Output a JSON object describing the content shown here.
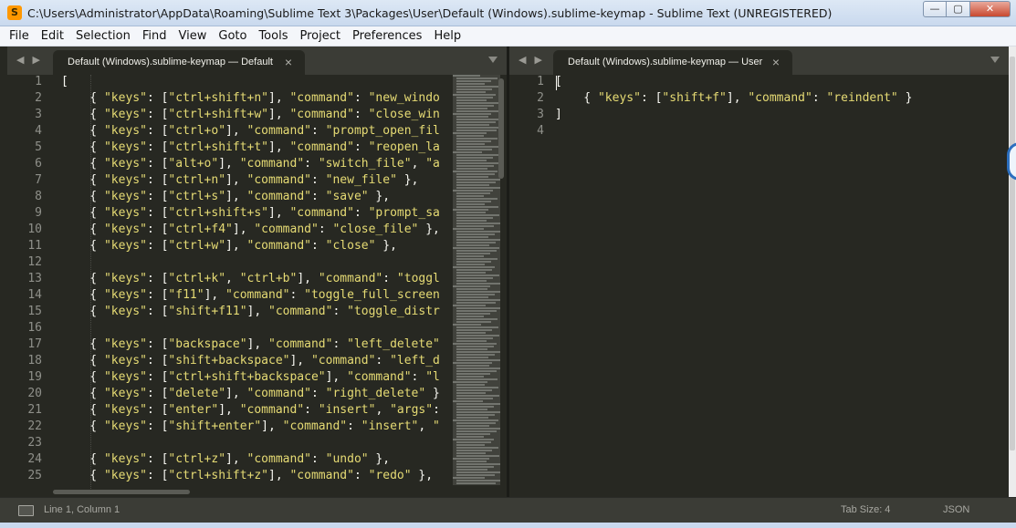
{
  "window": {
    "title": "C:\\Users\\Administrator\\AppData\\Roaming\\Sublime Text 3\\Packages\\User\\Default (Windows).sublime-keymap - Sublime Text (UNREGISTERED)",
    "app_icon_glyph": "S",
    "controls": {
      "minimize": "—",
      "maximize": "▢",
      "close": "✕"
    }
  },
  "menu": [
    "File",
    "Edit",
    "Selection",
    "Find",
    "View",
    "Goto",
    "Tools",
    "Project",
    "Preferences",
    "Help"
  ],
  "left_pane": {
    "nav_arrows": "◀ ▶",
    "tab_label": "Default (Windows).sublime-keymap — Default",
    "tab_close": "×",
    "line_numbers": [
      "1",
      "2",
      "3",
      "4",
      "5",
      "6",
      "7",
      "8",
      "9",
      "10",
      "11",
      "12",
      "13",
      "14",
      "15",
      "16",
      "17",
      "18",
      "19",
      "20",
      "21",
      "22",
      "23",
      "24",
      "25"
    ],
    "lines": [
      "[",
      "\t{ \"keys\": [\"ctrl+shift+n\"], \"command\": \"new_windo",
      "\t{ \"keys\": [\"ctrl+shift+w\"], \"command\": \"close_win",
      "\t{ \"keys\": [\"ctrl+o\"], \"command\": \"prompt_open_fil",
      "\t{ \"keys\": [\"ctrl+shift+t\"], \"command\": \"reopen_la",
      "\t{ \"keys\": [\"alt+o\"], \"command\": \"switch_file\", \"a",
      "\t{ \"keys\": [\"ctrl+n\"], \"command\": \"new_file\" },",
      "\t{ \"keys\": [\"ctrl+s\"], \"command\": \"save\" },",
      "\t{ \"keys\": [\"ctrl+shift+s\"], \"command\": \"prompt_sa",
      "\t{ \"keys\": [\"ctrl+f4\"], \"command\": \"close_file\" },",
      "\t{ \"keys\": [\"ctrl+w\"], \"command\": \"close\" },",
      "",
      "\t{ \"keys\": [\"ctrl+k\", \"ctrl+b\"], \"command\": \"toggl",
      "\t{ \"keys\": [\"f11\"], \"command\": \"toggle_full_screen",
      "\t{ \"keys\": [\"shift+f11\"], \"command\": \"toggle_distr",
      "",
      "\t{ \"keys\": [\"backspace\"], \"command\": \"left_delete\"",
      "\t{ \"keys\": [\"shift+backspace\"], \"command\": \"left_d",
      "\t{ \"keys\": [\"ctrl+shift+backspace\"], \"command\": \"l",
      "\t{ \"keys\": [\"delete\"], \"command\": \"right_delete\" }",
      "\t{ \"keys\": [\"enter\"], \"command\": \"insert\", \"args\":",
      "\t{ \"keys\": [\"shift+enter\"], \"command\": \"insert\", \"",
      "",
      "\t{ \"keys\": [\"ctrl+z\"], \"command\": \"undo\" },",
      "\t{ \"keys\": [\"ctrl+shift+z\"], \"command\": \"redo\" },"
    ]
  },
  "right_pane": {
    "nav_arrows": "◀ ▶",
    "tab_label": "Default (Windows).sublime-keymap — User",
    "tab_close": "×",
    "line_numbers": [
      "1",
      "2",
      "3",
      "4"
    ],
    "lines": [
      "[",
      "\t{ \"keys\": [\"shift+f\"], \"command\": \"reindent\" }",
      "]",
      ""
    ]
  },
  "status": {
    "position": "Line 1, Column 1",
    "tab_size": "Tab Size: 4",
    "syntax": "JSON"
  },
  "colors": {
    "editor_bg": "#272822",
    "string": "#e6db74",
    "text": "#f8f8f2",
    "gutter_text": "#8f908a",
    "tabbar_bg": "#3b3c36"
  }
}
